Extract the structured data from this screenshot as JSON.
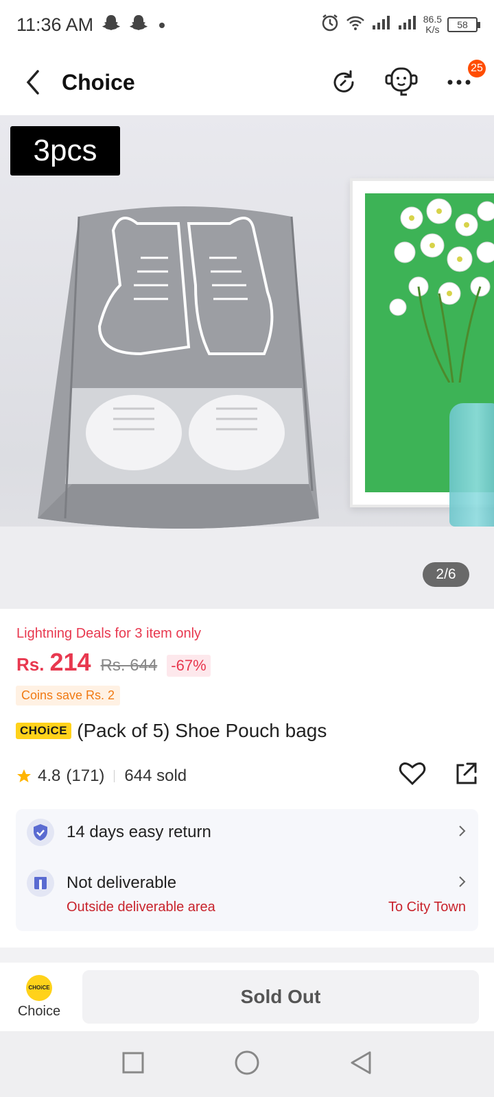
{
  "status_bar": {
    "time": "11:36 AM",
    "net_speed_value": "86.5",
    "net_speed_unit": "K/s",
    "battery": "58"
  },
  "header": {
    "title": "Choice",
    "cart_badge": "25"
  },
  "product_image": {
    "tag": "3pcs",
    "counter": "2/6"
  },
  "deal": {
    "text": "Lightning Deals for 3 item only",
    "currency": "Rs.",
    "price": "214",
    "old_price": "Rs. 644",
    "discount": "-67%",
    "coins": "Coins save Rs. 2"
  },
  "product": {
    "choice_badge": "CHOiCE",
    "title": "(Pack of 5) Shoe Pouch bags",
    "rating": "4.8",
    "reviews": "(171)",
    "sold": "644 sold"
  },
  "service": {
    "return_label": "14 days easy return",
    "delivery_label": "Not deliverable",
    "delivery_sub": "Outside deliverable area",
    "delivery_to": "To City Town"
  },
  "bottom": {
    "choice_logo": "CHOiCE",
    "choice_label": "Choice",
    "sold_out": "Sold Out"
  },
  "colors": {
    "accent_red": "#e8384f",
    "coin_orange": "#f07a13",
    "choice_yellow": "#ffd21a",
    "badge_orange": "#ff4d00"
  }
}
